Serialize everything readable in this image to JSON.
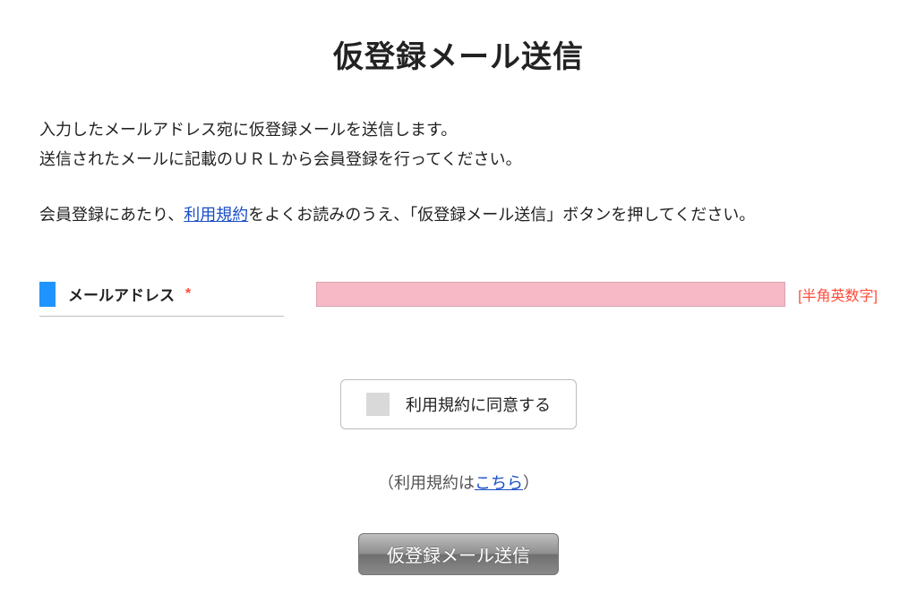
{
  "title": "仮登録メール送信",
  "description": {
    "line1": "入力したメールアドレス宛に仮登録メールを送信します。",
    "line2": "送信されたメールに記載のＵＲＬから会員登録を行ってください。"
  },
  "terms_line": {
    "pre": "会員登録にあたり、",
    "link": "利用規約",
    "post": "をよくお読みのうえ、「仮登録メール送信」ボタンを押してください。"
  },
  "form": {
    "email": {
      "label": "メールアドレス",
      "required_mark": "*",
      "value": "",
      "hint": "[半角英数字]"
    }
  },
  "agree": {
    "checked": false,
    "label": "利用規約に同意する"
  },
  "terms_link_line": {
    "pre": "（利用規約は",
    "link": "こちら",
    "post": "）"
  },
  "submit_label": "仮登録メール送信"
}
